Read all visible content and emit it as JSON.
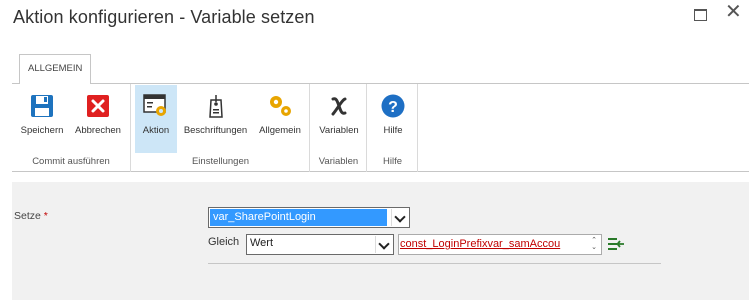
{
  "window": {
    "title": "Aktion konfigurieren - Variable setzen",
    "maximize_icon": "maximize-icon",
    "close_icon": "close-icon",
    "close_glyph": "✕"
  },
  "ribbon": {
    "tab": "ALLGEMEIN",
    "groups": [
      {
        "label": "Commit ausführen",
        "buttons": [
          {
            "label": "Speichern",
            "icon": "save-icon"
          },
          {
            "label": "Abbrechen",
            "icon": "cancel-icon"
          }
        ]
      },
      {
        "label": "Einstellungen",
        "buttons": [
          {
            "label": "Aktion",
            "icon": "action-settings-icon",
            "active": true
          },
          {
            "label": "Beschriftungen",
            "icon": "tag-icon"
          },
          {
            "label": "Allgemein",
            "icon": "gears-icon"
          }
        ]
      },
      {
        "label": "Variablen",
        "buttons": [
          {
            "label": "Variablen",
            "icon": "variable-x-icon"
          }
        ]
      },
      {
        "label": "Hilfe",
        "buttons": [
          {
            "label": "Hilfe",
            "icon": "help-icon"
          }
        ]
      }
    ]
  },
  "form": {
    "setze_label": "Setze",
    "required_marker": "*",
    "variable_value": "var_SharePointLogin",
    "gleich_label": "Gleich",
    "type_value": "Wert",
    "value_text": "const_LoginPrefixvar_samAccou",
    "spinner_up": "⌃",
    "spinner_down": "⌄"
  },
  "colors": {
    "accent_selection": "#3399ff",
    "active_button": "#cde6f7",
    "save_blue": "#1e73be",
    "cancel_red": "#e02020",
    "gear_gold": "#e8a500",
    "help_blue": "#1e6fc4",
    "value_red": "#c00000"
  }
}
